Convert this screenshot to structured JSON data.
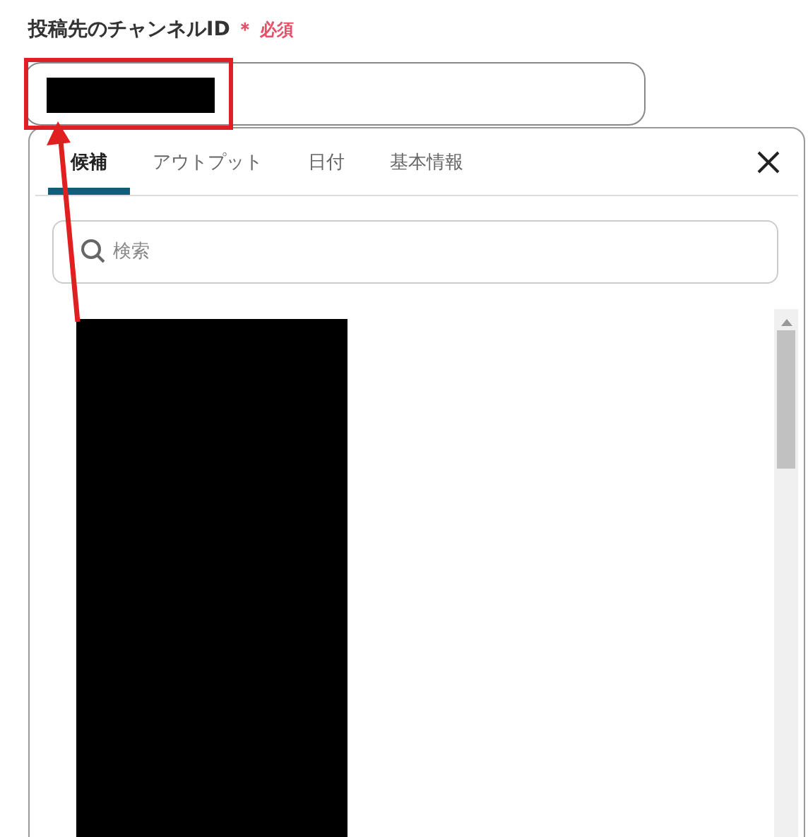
{
  "field": {
    "label": "投稿先のチャンネルID",
    "required_mark": "＊",
    "required_text": "必須"
  },
  "tabs": [
    {
      "label": "候補",
      "selected": true
    },
    {
      "label": "アウトプット",
      "selected": false
    },
    {
      "label": "日付",
      "selected": false
    },
    {
      "label": "基本情報",
      "selected": false
    }
  ],
  "search": {
    "placeholder": "検索"
  }
}
